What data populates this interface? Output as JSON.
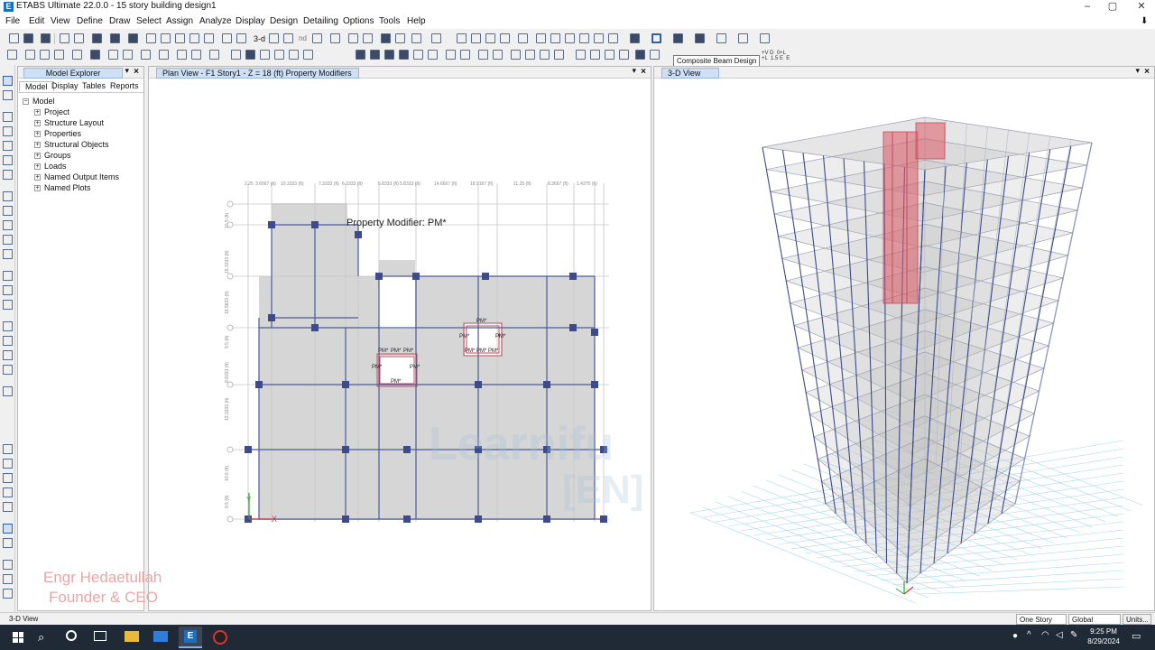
{
  "window": {
    "title": "ETABS Ultimate 22.0.0 - 15 story building design1",
    "app_icon": "E"
  },
  "menu": [
    "File",
    "Edit",
    "View",
    "Define",
    "Draw",
    "Select",
    "Assign",
    "Analyze",
    "Display",
    "Design",
    "Detailing",
    "Options",
    "Tools",
    "Help"
  ],
  "tooltip": "Composite Beam Design",
  "toolbar_text": {
    "three_d": "3-d",
    "nd": "nd",
    "load_cases": "+V D  0+L\n+L  1.5 E  E"
  },
  "explorer": {
    "title": "Model Explorer",
    "tabs": [
      "Model",
      "Display",
      "Tables",
      "Reports"
    ],
    "root": "Model",
    "items": [
      "Project",
      "Structure Layout",
      "Properties",
      "Structural Objects",
      "Groups",
      "Loads",
      "Named Output Items",
      "Named Plots"
    ]
  },
  "plan_view": {
    "title": "Plan View - F1 Story1 - Z = 18 (ft)  Property Modifiers",
    "annotation": "Property Modifier: PM*",
    "pm_label": "PM*",
    "dim_labels": [
      "2.25",
      "3.6667 (ft)",
      "10.3333 (ft)",
      "7.3333 (ft)",
      "6.3333 (ft)",
      "5.8333 (ft)",
      "5.8333 (ft)",
      "14.6667 (ft)",
      "18.9167 (ft)",
      "11.25 (ft)",
      "8.3667 (ft)",
      "1.4375 (ft)"
    ],
    "side_labels": [
      "10.5 (ft)",
      "15.3333 (ft)",
      "19.5833 (ft)",
      "9.5 (ft)",
      "8.8333 (ft)",
      "13.3333 (ft)",
      "10.6 (ft)",
      "9.5 (ft)"
    ]
  },
  "view3d": {
    "title": "3-D View"
  },
  "watermark": {
    "line1": "Engr Hedaetullah",
    "line2": "Founder & CEO",
    "center": "Learnifu",
    "center2": "[EN]"
  },
  "statusbar": {
    "left": "3-D View",
    "story": "One Story",
    "coord": "Global",
    "units": "Units..."
  },
  "taskbar": {
    "time": "9:25 PM",
    "date": "8/29/2024"
  },
  "colors": {
    "beam": "#4a5a9a",
    "column": "#3d4a8c",
    "slab": "#d6d6d6",
    "pm_red": "#c24a5a",
    "axis_green": "#2aa82a",
    "axis_red": "#e53030"
  }
}
